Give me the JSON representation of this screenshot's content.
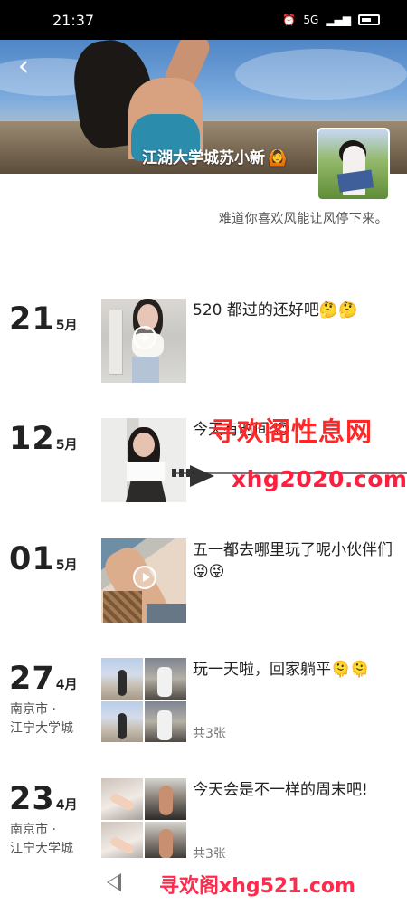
{
  "status_bar": {
    "time": "21:37",
    "network": "5G",
    "signal_icon": "signal-bars-icon",
    "wifi_icon": "wifi-icon",
    "battery_icon": "battery-icon"
  },
  "profile": {
    "name": "江湖大学城苏小新",
    "emoji": "🙆",
    "signature": "难道你喜欢风能让风停下来。",
    "back_icon": "chevron-left-icon"
  },
  "posts": [
    {
      "day": "21",
      "month": "5月",
      "text": "520 都过的还好吧🤔🤔",
      "location_line1": "",
      "location_line2": "",
      "count": ""
    },
    {
      "day": "12",
      "month": "5月",
      "text": "今天有时间 😊",
      "location_line1": "",
      "location_line2": "",
      "count": ""
    },
    {
      "day": "01",
      "month": "5月",
      "text": "五一都去哪里玩了呢小伙伴们😜😜",
      "location_line1": "",
      "location_line2": "",
      "count": ""
    },
    {
      "day": "27",
      "month": "4月",
      "text": "玩一天啦，回家躺平🫠🫠",
      "location_line1": "南京市 ·",
      "location_line2": "江宁大学城",
      "count": "共3张"
    },
    {
      "day": "23",
      "month": "4月",
      "text": "今天会是不一样的周末吧!",
      "location_line1": "南京市 ·",
      "location_line2": "江宁大学城",
      "count": "共3张"
    }
  ],
  "watermarks": {
    "title": "寻欢阁性息网",
    "url": "xhg2020.com",
    "footer": "寻欢阁xhg521.com"
  },
  "colors": {
    "accent_red": "#ff2828",
    "status_bar": "#000000",
    "background": "#ffffff"
  }
}
